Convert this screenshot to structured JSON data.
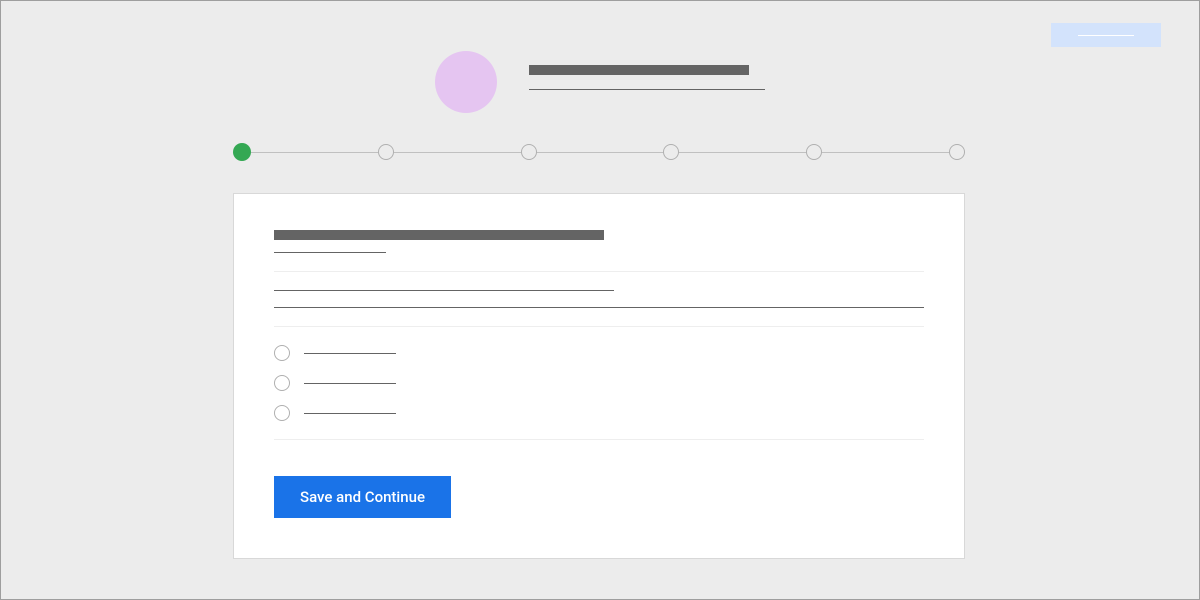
{
  "colors": {
    "accent_primary": "#1a73e8",
    "accent_success": "#34a853",
    "brand_circle": "#e5c5f1",
    "notif_bg": "#d3e3fc",
    "skeleton": "#646464",
    "page_bg": "#ececec"
  },
  "header": {
    "notif_text": "",
    "brand_title": "",
    "brand_subtitle": ""
  },
  "stepper": {
    "total": 6,
    "active_index": 0
  },
  "card": {
    "section_heading": "",
    "section_sub": "",
    "field_label": "",
    "field_value": "",
    "radios": [
      {
        "label": ""
      },
      {
        "label": ""
      },
      {
        "label": ""
      }
    ],
    "save_label": "Save and Continue"
  }
}
